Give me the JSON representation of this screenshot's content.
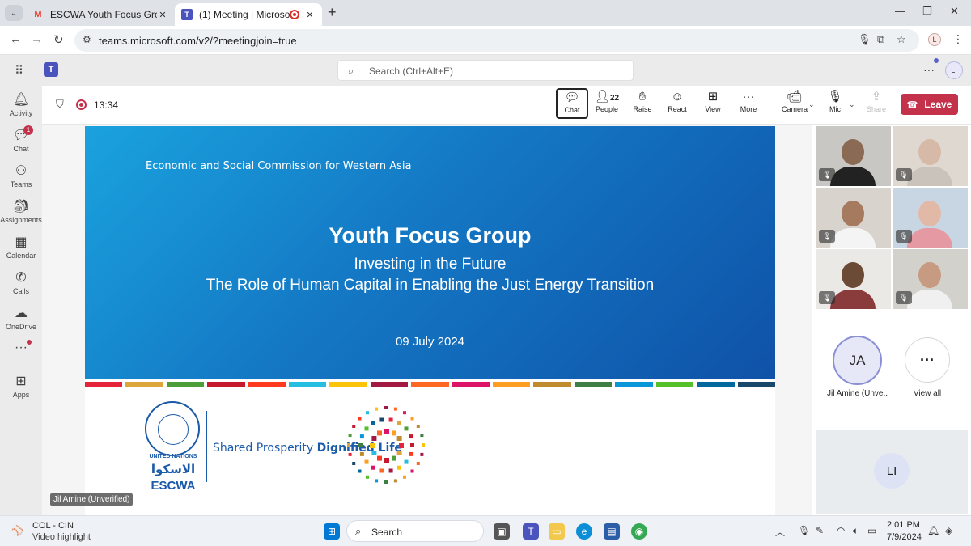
{
  "browser": {
    "tabs": [
      {
        "title": "ESCWA Youth Focus Group - Im",
        "favicon": "gmail-icon"
      },
      {
        "title": "(1) Meeting | Microsoft Tear",
        "favicon": "teams-icon",
        "recording": true
      }
    ],
    "url": "teams.microsoft.com/v2/?meetingjoin=true",
    "profile_initial": "L"
  },
  "teams": {
    "search_placeholder": "Search (Ctrl+Alt+E)",
    "avatar_initials": "LI",
    "rail": [
      {
        "label": "Activity",
        "icon": "bell-icon"
      },
      {
        "label": "Chat",
        "icon": "chat-icon",
        "badge": "1"
      },
      {
        "label": "Teams",
        "icon": "teams-people-icon"
      },
      {
        "label": "Assignments",
        "icon": "backpack-icon"
      },
      {
        "label": "Calendar",
        "icon": "calendar-icon"
      },
      {
        "label": "Calls",
        "icon": "phone-icon"
      },
      {
        "label": "OneDrive",
        "icon": "cloud-icon"
      },
      {
        "label": "",
        "icon": "more-icon"
      },
      {
        "label": "Apps",
        "icon": "plus-box-icon"
      }
    ]
  },
  "meeting": {
    "timer": "13:34",
    "people_count": "22",
    "buttons": {
      "chat": "Chat",
      "people": "People",
      "raise": "Raise",
      "react": "React",
      "view": "View",
      "more": "More",
      "camera": "Camera",
      "mic": "Mic",
      "share": "Share",
      "leave": "Leave"
    }
  },
  "slide": {
    "org": "Economic and Social Commission for Western Asia",
    "title": "Youth Focus Group",
    "subtitle1": "Investing in the Future",
    "subtitle2": "The Role of Human Capital in Enabling the Just Energy Transition",
    "date": "09 July 2024",
    "un_name": "UNITED NATIONS",
    "un_arabic": "الاسكوا",
    "un_abbr": "ESCWA",
    "tagline_a": "Shared Prosperity ",
    "tagline_b": "Dignified Life",
    "colorbar": [
      "#e5243b",
      "#dda63a",
      "#4c9f38",
      "#c5192d",
      "#ff3a21",
      "#26bde2",
      "#fcc30b",
      "#a21942",
      "#fd6925",
      "#dd1367",
      "#fd9d24",
      "#bf8b2e",
      "#3f7e44",
      "#0a97d9",
      "#56c02b",
      "#00689d",
      "#19486a"
    ]
  },
  "presenter_label": "Jil Amine (Unverified)",
  "participants": {
    "featured_initials": "JA",
    "featured_name": "Jil Amine (Unve...",
    "view_all": "View all",
    "self_initials": "LI"
  },
  "taskbar": {
    "news_line1": "COL - CIN",
    "news_line2": "Video highlight",
    "search_label": "Search",
    "time": "2:01 PM",
    "date": "7/9/2024"
  }
}
